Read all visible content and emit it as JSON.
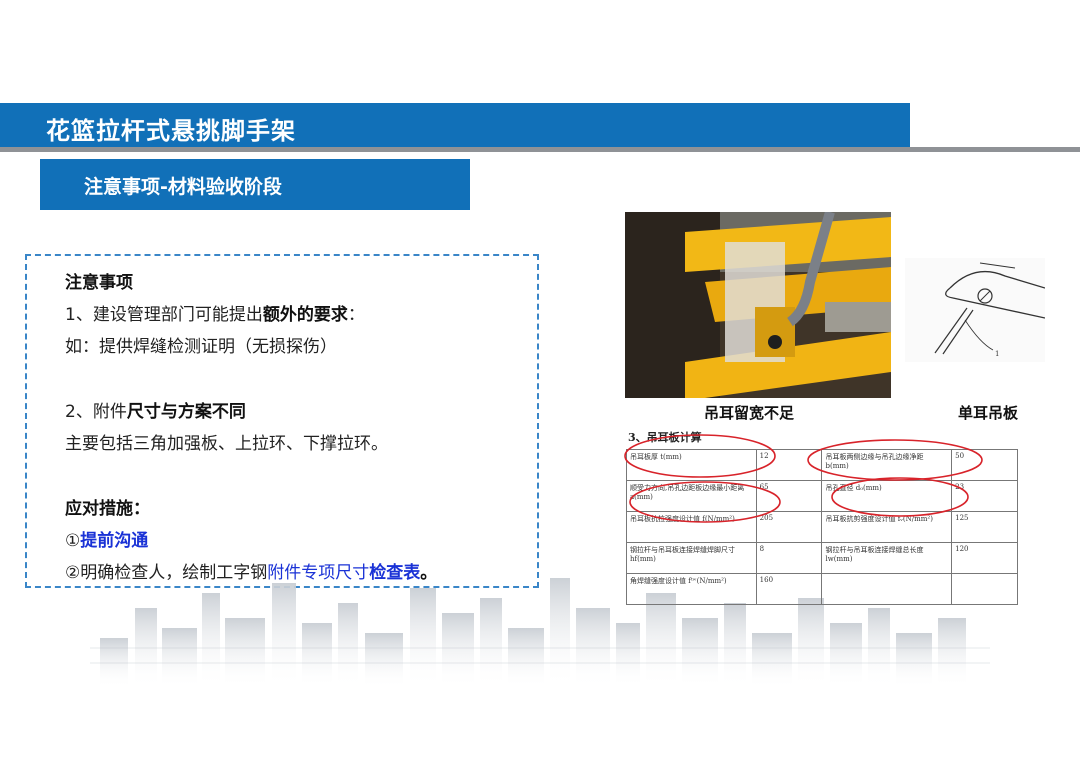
{
  "header": {
    "title": "花篮拉杆式悬挑脚手架",
    "subtitle": "注意事项-材料验收阶段"
  },
  "notes": {
    "heading": "注意事项",
    "item1_prefix": "1、建设管理部门可能提出",
    "item1_bold": "额外的要求",
    "item1_suffix": "：",
    "example": "如：提供焊缝检测证明（无损探伤）",
    "item2_prefix": "2、附件",
    "item2_bold": "尺寸与方案不同",
    "item2_detail": "主要包括三角加强板、上拉环、下撑拉环。",
    "measures_heading": "应对措施：",
    "measure1_prefix": "①",
    "measure1_text": "提前沟通",
    "measure2_prefix": "②明确检查人，绘制工字钢",
    "measure2_blue": "附件专项尺寸",
    "measure2_bold": "检查表",
    "measure2_suffix": "。"
  },
  "images": {
    "photo_caption": "吊耳留宽不足",
    "drawing_caption": "单耳吊板",
    "drawing_label": "1"
  },
  "calc": {
    "title": "3、吊耳板计算",
    "rows": [
      [
        "吊耳板厚 t(mm)",
        "12",
        "吊耳板两侧边缘与吊孔边缘净距 b(mm)",
        "50"
      ],
      [
        "顺受力方向,吊孔边距板边缘最小距离 a(mm)",
        "65",
        "吊孔直径 d₀(mm)",
        "23"
      ],
      [
        "吊耳板抗拉强度设计值 f(N/mm²)",
        "205",
        "吊耳板抗剪强度设计值 fᵥ(N/mm²)",
        "125"
      ],
      [
        "钢拉杆与吊耳板连接焊缝焊脚尺寸 hf(mm)",
        "8",
        "钢拉杆与吊耳板连接焊缝总长度 lw(mm)",
        "120"
      ],
      [
        "角焊缝强度设计值 fᵗʷ(N/mm²)",
        "160",
        "",
        ""
      ]
    ]
  },
  "colors": {
    "brand_blue": "#1170b8",
    "highlight_blue": "#1a32d6",
    "annotation_red": "#d8232a"
  }
}
